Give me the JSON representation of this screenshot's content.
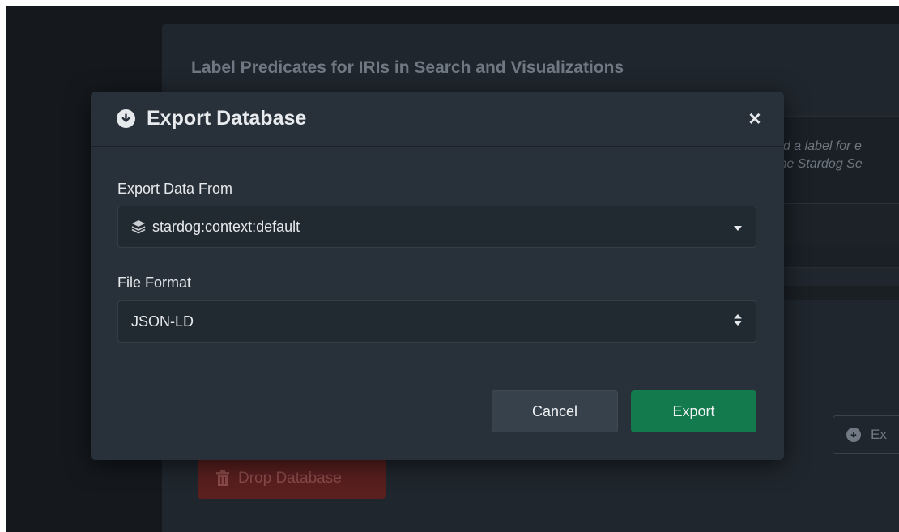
{
  "background": {
    "panel_title": "Label Predicates for IRIs in Search and Visualizations",
    "hint_lines": [
      "nd a label for e",
      "the Stardog Se"
    ],
    "export_button_label": "Ex",
    "drop_button_label": "Drop Database"
  },
  "modal": {
    "title": "Export Database",
    "close_label": "×",
    "export_from": {
      "label": "Export Data From",
      "value": "stardog:context:default"
    },
    "file_format": {
      "label": "File Format",
      "value": "JSON-LD"
    },
    "cancel_label": "Cancel",
    "export_label": "Export"
  },
  "colors": {
    "accent_export": "#137a4d",
    "danger": "#5a1f1f",
    "modal_bg": "#28313a"
  }
}
